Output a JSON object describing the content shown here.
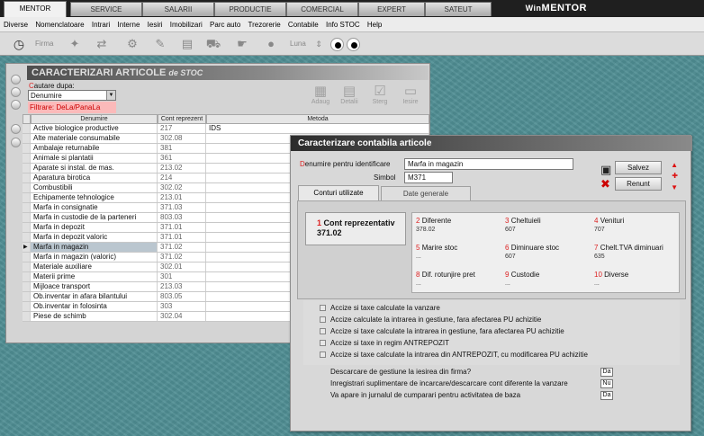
{
  "modules": [
    "MENTOR",
    "SERVICE",
    "SALARII",
    "PRODUCTIE",
    "COMERCIAL",
    "EXPERT",
    "SATEUT"
  ],
  "brand": {
    "w": "Win",
    "rest": "MENTOR"
  },
  "menu": [
    "Diverse",
    "Nomenclatoare",
    "Intrari",
    "Interne",
    "Iesiri",
    "Imobilizari",
    "Parc auto",
    "Trezorerie",
    "Contabile",
    "Info STOC",
    "Help"
  ],
  "toolbar": {
    "firma": "Firma",
    "luna": "Luna"
  },
  "list": {
    "title": "CARACTERIZARI ARTICOLE",
    "title_sub": "de STOC",
    "search_label_hl": "C",
    "search_label": "autare dupa:",
    "search_value": "Denumire",
    "filter": "Filtrare: DeLa/PanaLa",
    "actions": [
      "Adaug",
      "Detalii",
      "Sterg",
      "Iesire"
    ],
    "columns": [
      "Denumire",
      "Cont reprezent",
      "Metoda"
    ],
    "rows": [
      {
        "name": "Active biologice productive",
        "cont": "217",
        "metoda": "IDS"
      },
      {
        "name": "Alte materiale consumabile",
        "cont": "302.08",
        "metoda": ""
      },
      {
        "name": "Ambalaje returnabile",
        "cont": "381",
        "metoda": ""
      },
      {
        "name": "Animale si plantatii",
        "cont": "361",
        "metoda": ""
      },
      {
        "name": "Aparate si instal. de mas.",
        "cont": "213.02",
        "metoda": ""
      },
      {
        "name": "Aparatura birotica",
        "cont": "214",
        "metoda": ""
      },
      {
        "name": "Combustibili",
        "cont": "302.02",
        "metoda": ""
      },
      {
        "name": "Echipamente tehnologice",
        "cont": "213.01",
        "metoda": ""
      },
      {
        "name": "Marfa in consignatie",
        "cont": "371.03",
        "metoda": ""
      },
      {
        "name": "Marfa in custodie de la parteneri",
        "cont": "803.03",
        "metoda": ""
      },
      {
        "name": "Marfa in depozit",
        "cont": "371.01",
        "metoda": ""
      },
      {
        "name": "Marfa in depozit valoric",
        "cont": "371.01",
        "metoda": ""
      },
      {
        "name": "Marfa in magazin",
        "cont": "371.02",
        "metoda": ""
      },
      {
        "name": "Marfa in magazin (valoric)",
        "cont": "371.02",
        "metoda": ""
      },
      {
        "name": "Materiale auxiliare",
        "cont": "302.01",
        "metoda": ""
      },
      {
        "name": "Materii prime",
        "cont": "301",
        "metoda": ""
      },
      {
        "name": "Mijloace transport",
        "cont": "213.03",
        "metoda": ""
      },
      {
        "name": "Ob.inventar in afara bilantului",
        "cont": "803.05",
        "metoda": ""
      },
      {
        "name": "Ob.inventar in folosinta",
        "cont": "303",
        "metoda": ""
      },
      {
        "name": "Piese de schimb",
        "cont": "302.04",
        "metoda": ""
      }
    ],
    "selected_index": 12
  },
  "dialog": {
    "title": "Caracterizare contabila articole",
    "denumire_label_hl": "D",
    "denumire_label": "enumire pentru identificare",
    "denumire_value": "Marfa in magazin",
    "simbol_label": "Simbol",
    "simbol_value": "M371",
    "save": "Salvez",
    "cancel": "Renunt",
    "tabs": [
      "Conturi utilizate",
      "Date generale"
    ],
    "cont_reprezentativ": {
      "num": "1",
      "label": "Cont reprezentativ",
      "value": "371.02"
    },
    "accounts": [
      {
        "num": "2",
        "label": "Diferente",
        "value": "378.02"
      },
      {
        "num": "3",
        "label": "Cheltuieli",
        "value": "607"
      },
      {
        "num": "4",
        "label": "Venituri",
        "value": "707"
      },
      {
        "num": "5",
        "label": "Marire stoc",
        "value": "..."
      },
      {
        "num": "6",
        "label": "Diminuare stoc",
        "value": "607"
      },
      {
        "num": "7",
        "label": "Chelt.TVA diminuari",
        "value": "635"
      },
      {
        "num": "8",
        "label": "Dif. rotunjire pret",
        "value": "..."
      },
      {
        "num": "9",
        "label": "Custodie",
        "value": "..."
      },
      {
        "num": "10",
        "label": "Diverse",
        "value": "..."
      }
    ],
    "checks": [
      "Accize si taxe calculate la vanzare",
      "Accize calculate la intrarea in gestiune, fara afectarea PU achizitie",
      "Accize si taxe calculate la intrarea in gestiune, fara afectarea PU achizitie",
      "Accize si taxe in regim ANTREPOZIT",
      "Accize si taxe calculate la intrarea din ANTREPOZIT, cu modificarea PU achizitie"
    ],
    "questions": [
      {
        "text": "Descarcare de gestiune la iesirea din firma?",
        "answer": "Da"
      },
      {
        "text": "Inregistrari suplimentare de incarcare/descarcare cont diferente la vanzare",
        "answer": "Nu"
      },
      {
        "text": "Va apare in jurnalul de cumparari pentru activitatea de baza",
        "answer": "Da"
      }
    ]
  }
}
